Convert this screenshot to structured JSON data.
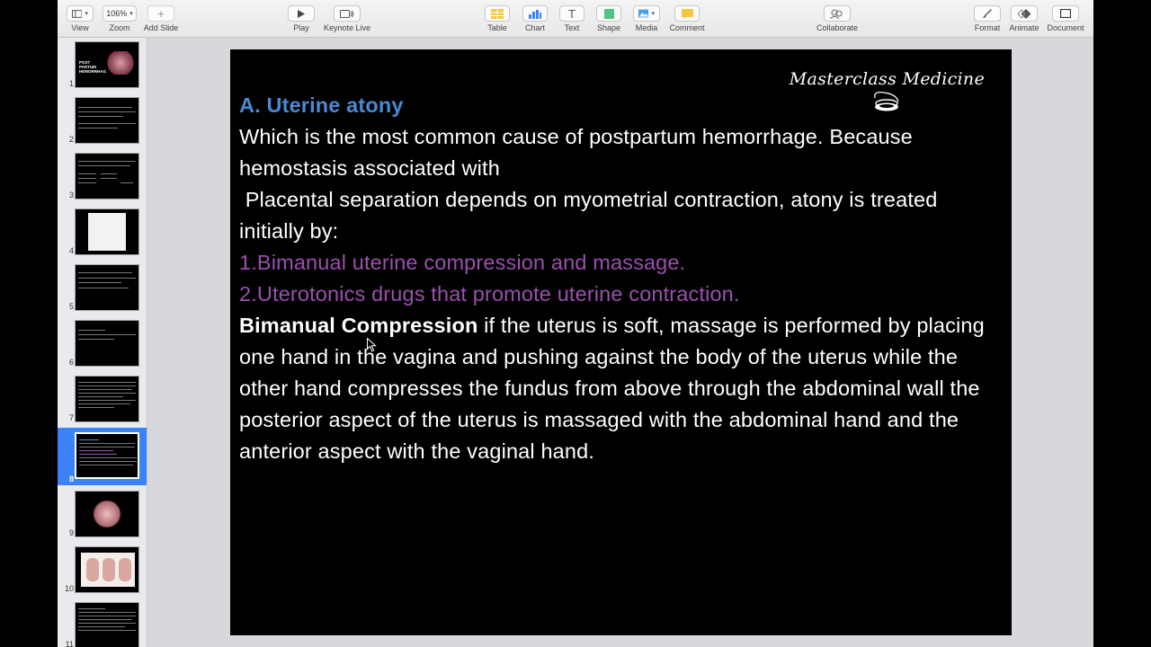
{
  "toolbar": {
    "view": "View",
    "zoom_value": "106%",
    "zoom": "Zoom",
    "add_slide": "Add Slide",
    "play": "Play",
    "keynote_live": "Keynote Live",
    "table": "Table",
    "chart": "Chart",
    "text": "Text",
    "shape": "Shape",
    "media": "Media",
    "comment": "Comment",
    "collaborate": "Collaborate",
    "format": "Format",
    "animate": "Animate",
    "document": "Document"
  },
  "navigator": {
    "selected": 8,
    "slides": [
      "1",
      "2",
      "3",
      "4",
      "5",
      "6",
      "7",
      "8",
      "9",
      "10",
      "11"
    ],
    "slide1_title": "POST PARTUM HEMORRHAGE"
  },
  "slide": {
    "brand": "Masterclass Medicine",
    "heading": "A. Uterine atony",
    "line1": "Which is the most common cause of postpartum hemorrhage. Because hemostasis associated with",
    "line2": " Placental separation depends on myometrial contraction, atony is treated initially by:",
    "item1": "1.Bimanual uterine compression and massage.",
    "item2": "2.Uterotonics drugs that promote uterine contraction.",
    "bold_lead": "Bimanual Compression",
    "paragraph": " if the uterus is soft, massage is performed by placing one hand in the vagina and pushing against the body of the uterus while the other hand compresses the fundus from above through the abdominal wall the posterior aspect of the uterus is massaged with the abdominal hand and the anterior aspect with the vaginal hand."
  },
  "colors": {
    "heading_blue": "#4a8ad4",
    "list_purple": "#9c4fae",
    "selection_blue": "#3a82f6"
  }
}
